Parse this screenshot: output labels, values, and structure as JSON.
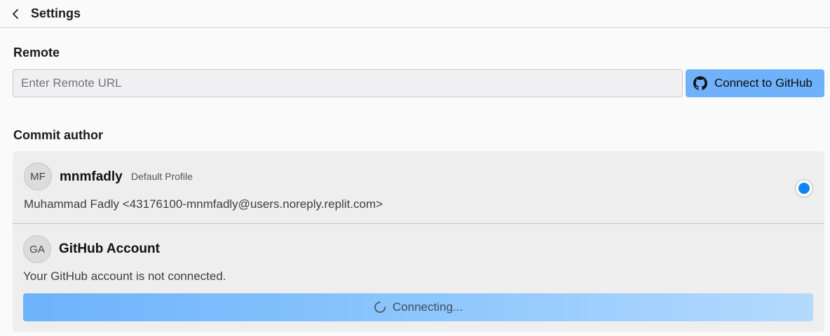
{
  "header": {
    "title": "Settings",
    "back_icon": "chevron-left-icon"
  },
  "remote": {
    "section_title": "Remote",
    "input_placeholder": "Enter Remote URL",
    "input_value": "",
    "connect_label": "Connect to GitHub",
    "connect_icon": "github-icon",
    "connect_color": "#6fb2fb"
  },
  "commit_author": {
    "section_title": "Commit author",
    "profile": {
      "avatar_initials": "MF",
      "username": "mnmfadly",
      "badge": "Default Profile",
      "identity": "Muhammad Fadly <43176100-mnmfadly@users.noreply.replit.com>",
      "selected": true
    },
    "github": {
      "avatar_initials": "GA",
      "title": "GitHub Account",
      "status": "Your GitHub account is not connected.",
      "button_label": "Connecting...",
      "button_icon": "spinner-icon"
    }
  },
  "colors": {
    "accent": "#0f84f5",
    "button_blue": "#6fb2fb",
    "card_bg": "#eeeeef",
    "page_bg": "#fafafa"
  }
}
